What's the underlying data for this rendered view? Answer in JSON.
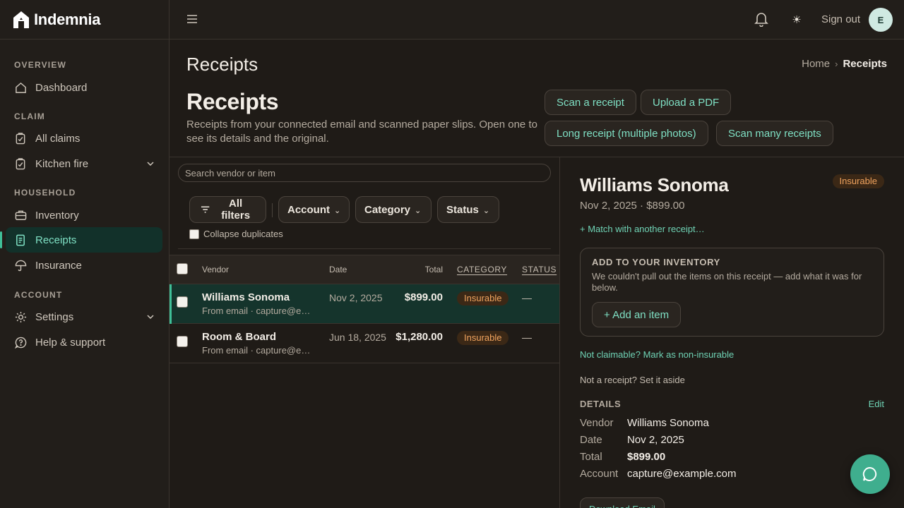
{
  "app": {
    "name": "Indemnia"
  },
  "sidebar": {
    "sections": [
      {
        "label": "OVERVIEW"
      },
      {
        "label": "CLAIM"
      },
      {
        "label": "HOUSEHOLD"
      },
      {
        "label": "ACCOUNT"
      }
    ],
    "items": {
      "dashboard": "Dashboard",
      "all_claims": "All claims",
      "kitchen_fire": "Kitchen fire",
      "inventory": "Inventory",
      "receipts": "Receipts",
      "insurance": "Insurance",
      "settings": "Settings",
      "help": "Help & support"
    },
    "active_item": "receipts"
  },
  "topbar": {
    "sign_out": "Sign out",
    "avatar_initial": "E",
    "theme_icon": "☀"
  },
  "page": {
    "title_top": "Receipts",
    "breadcrumb": {
      "home": "Home",
      "separator": "›",
      "current": "Receipts"
    },
    "title": "Receipts",
    "description": "Receipts from your connected email and scanned paper slips. Open one to see its details and the original.",
    "actions": {
      "scan": "Scan a receipt",
      "upload": "Upload a PDF",
      "long": "Long receipt (multiple photos)",
      "scan_many": "Scan many receipts"
    }
  },
  "list": {
    "search_placeholder": "Search vendor or item",
    "filters": {
      "all": "All filters",
      "account": "Account",
      "category": "Category",
      "status": "Status"
    },
    "collapse_duplicates": "Collapse duplicates",
    "columns": {
      "vendor": "Vendor",
      "date": "Date",
      "total": "Total",
      "category": "CATEGORY",
      "status": "STATUS"
    },
    "rows": [
      {
        "vendor": "Williams Sonoma",
        "source": "From email · capture@example.com",
        "date": "Nov 2, 2025",
        "total": "$899.00",
        "category": "Insurable",
        "status": "—",
        "selected": true
      },
      {
        "vendor": "Room & Board",
        "source": "From email · capture@example.com",
        "date": "Jun 18, 2025",
        "total": "$1,280.00",
        "category": "Insurable",
        "status": "—",
        "selected": false
      }
    ]
  },
  "detail": {
    "vendor": "Williams Sonoma",
    "subtitle": "Nov 2, 2025 · $899.00",
    "badge": "Insurable",
    "match_link": "+ Match with another receipt…",
    "inventory": {
      "heading": "ADD TO YOUR INVENTORY",
      "description": "We couldn't pull out the items on this receipt — add what it was for below.",
      "add_button": "+ Add an item"
    },
    "non_insurable_link": "Not claimable? Mark as non-insurable",
    "not_receipt_link": "Not a receipt? Set it aside",
    "details_heading": "DETAILS",
    "edit_link": "Edit",
    "fields": {
      "vendor_label": "Vendor",
      "vendor_value": "Williams Sonoma",
      "date_label": "Date",
      "date_value": "Nov 2, 2025",
      "total_label": "Total",
      "total_value": "$899.00",
      "account_label": "Account",
      "account_value": "capture@example.com"
    },
    "download_button": "Download Email"
  },
  "colors": {
    "accent": "#3fbf98",
    "accent_text": "#7fe0c4",
    "badge_bg": "#3b2816",
    "badge_text": "#f0a35e",
    "background": "#1f1b17"
  },
  "icons": {
    "logo": "house-logo-icon",
    "menu": "hamburger-menu-icon",
    "bell": "bell-icon",
    "theme": "sun-icon",
    "chat": "chat-bubble-icon"
  }
}
